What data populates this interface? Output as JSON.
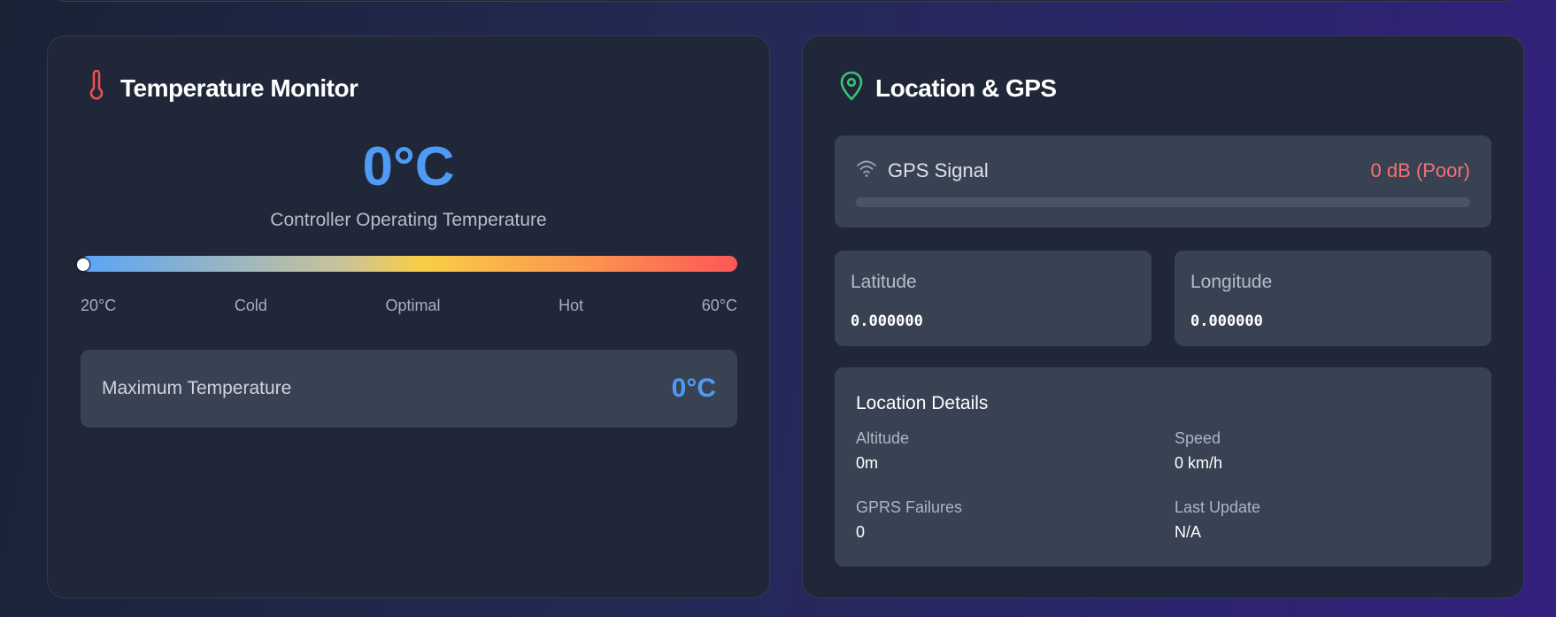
{
  "temperature": {
    "title": "Temperature Monitor",
    "icon": "thermometer-icon",
    "value": "0°C",
    "subtitle": "Controller Operating Temperature",
    "gauge_level": 0,
    "scale": [
      "20°C",
      "Cold",
      "Optimal",
      "Hot",
      "60°C"
    ],
    "max_label": "Maximum Temperature",
    "max_value": "0°C"
  },
  "gps": {
    "title": "Location & GPS",
    "icon": "map-pin-icon",
    "signal": {
      "label": "GPS Signal",
      "value": "0 dB (Poor)",
      "icon": "wifi-signal-icon",
      "level": 0
    },
    "latitude": {
      "label": "Latitude",
      "value": "0.000000"
    },
    "longitude": {
      "label": "Longitude",
      "value": "0.000000"
    },
    "details": {
      "title": "Location Details",
      "items": [
        {
          "label": "Altitude",
          "value": "0m"
        },
        {
          "label": "Speed",
          "value": "0 km/h"
        },
        {
          "label": "GPRS Failures",
          "value": "0"
        },
        {
          "label": "Last Update",
          "value": "N/A"
        }
      ]
    }
  },
  "colors": {
    "accent_blue": "#4f9af5",
    "poor_red": "#f47171",
    "thermometer_red": "#ef4f4f",
    "pin_green": "#3fc177"
  }
}
